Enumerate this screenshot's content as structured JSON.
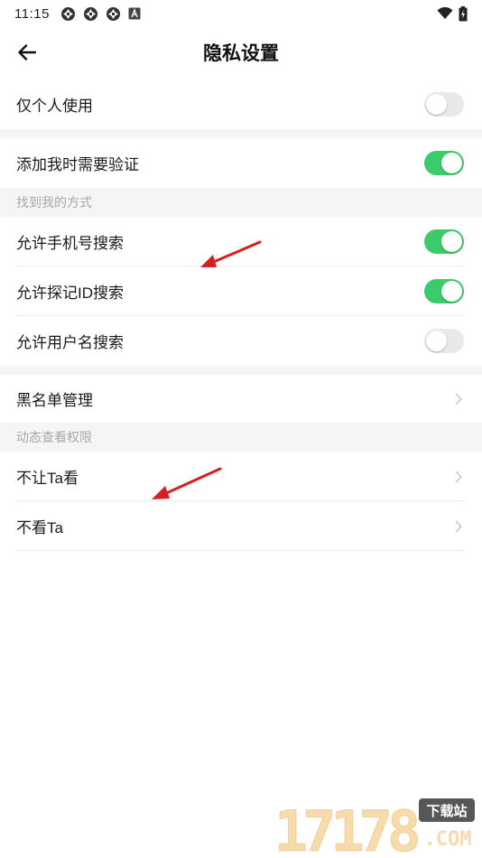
{
  "status_bar": {
    "time": "11:15",
    "left_icons": [
      "sync-icon",
      "sync-icon",
      "sync-icon",
      "notification-a-icon"
    ],
    "right_icons": [
      "wifi-icon",
      "battery-icon"
    ]
  },
  "header": {
    "title": "隐私设置",
    "back_icon": "back-arrow-icon"
  },
  "settings": {
    "personal_only": {
      "label": "仅个人使用",
      "enabled": false
    },
    "verify_on_add": {
      "label": "添加我时需要验证",
      "enabled": true
    }
  },
  "find_me": {
    "header": "找到我的方式",
    "items": [
      {
        "label": "允许手机号搜索",
        "enabled": true
      },
      {
        "label": "允许探记ID搜索",
        "enabled": true
      },
      {
        "label": "允许用户名搜索",
        "enabled": false
      }
    ]
  },
  "blacklist": {
    "label": "黑名单管理"
  },
  "feed_permissions": {
    "header": "动态查看权限",
    "items": [
      {
        "label": "不让Ta看"
      },
      {
        "label": "不看Ta"
      }
    ]
  },
  "watermark": {
    "text": "17178",
    "badge": "下载站",
    "suffix": ".COM"
  },
  "colors": {
    "toggle_on": "#3ccb6a",
    "toggle_off": "#e9e9e9",
    "section_bg": "#f5f5f5",
    "annotation_arrow": "#d42020"
  }
}
